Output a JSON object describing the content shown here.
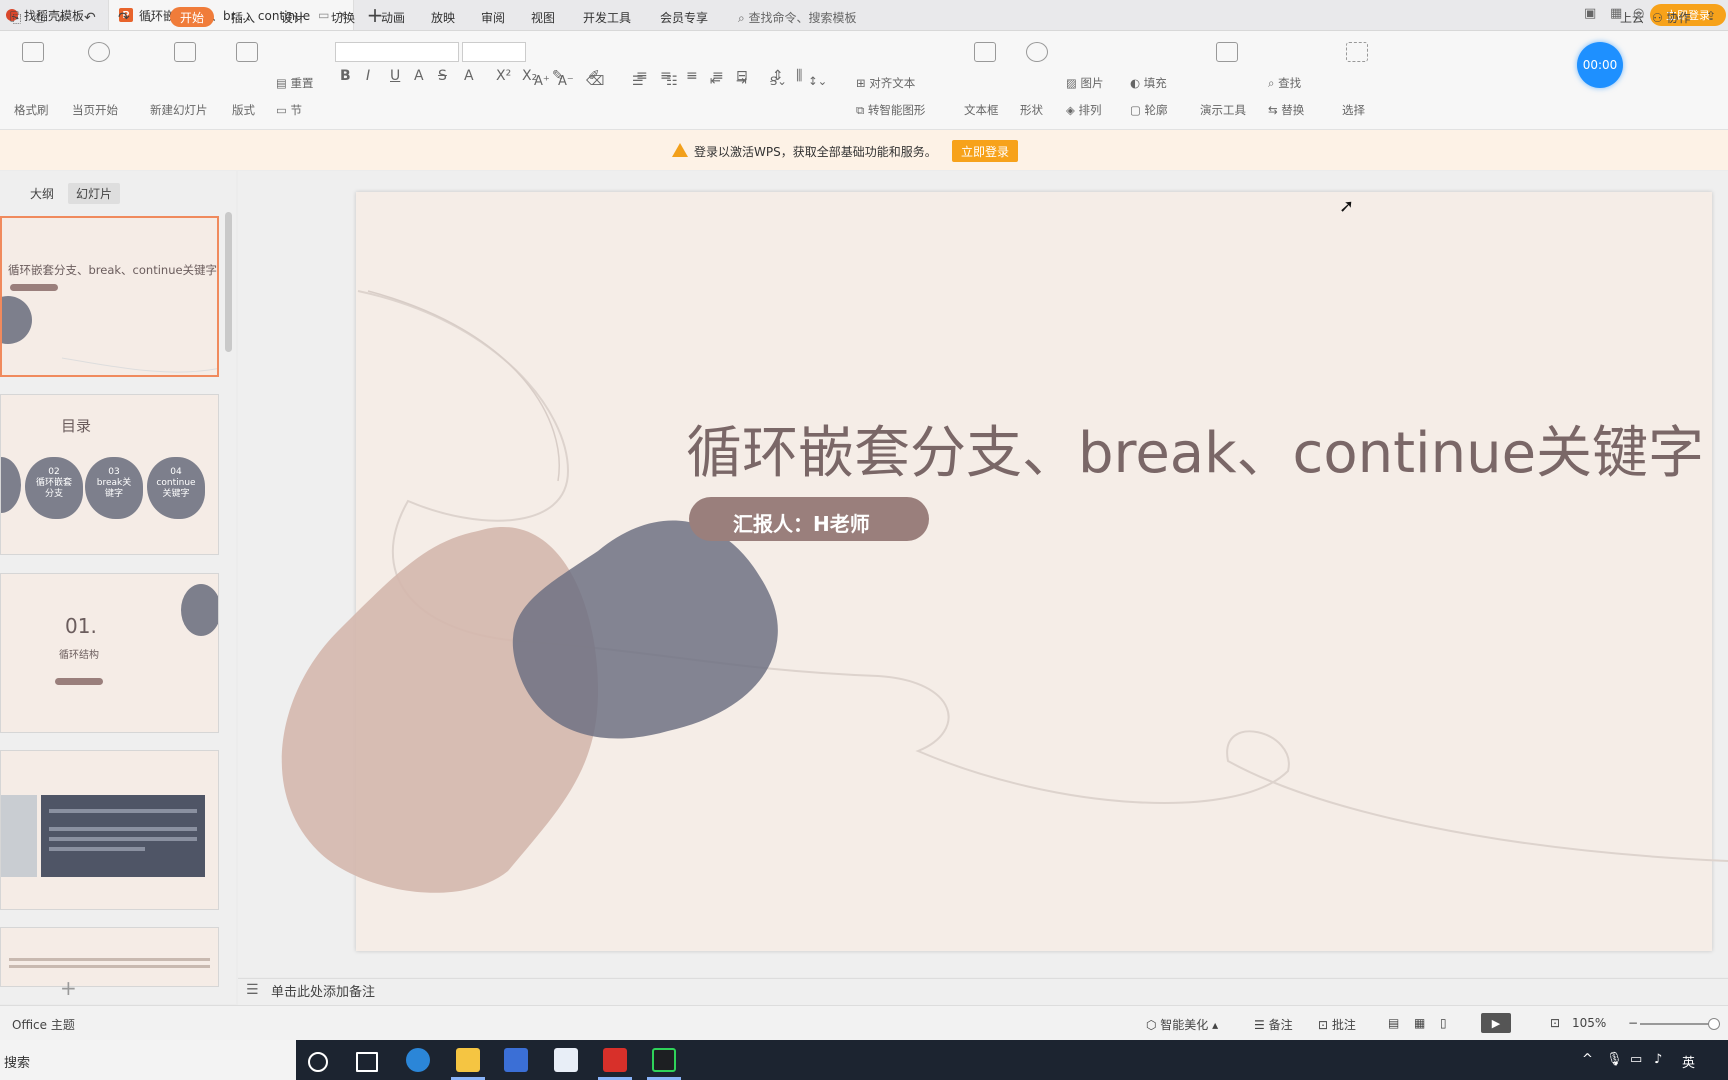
{
  "tabs": [
    {
      "label": "找稻壳模板"
    },
    {
      "label": "循环嵌套分支、br...、continue"
    }
  ],
  "titlebar": {
    "login_label": "立即登录"
  },
  "menu": {
    "start": "开始",
    "items": [
      "插入",
      "设计",
      "切换",
      "动画",
      "放映",
      "审阅",
      "视图",
      "开发工具",
      "会员专享"
    ],
    "search_placeholder": "查找命令、搜索模板",
    "cloud": "上云",
    "collab": "协作"
  },
  "timer": "00:00",
  "ribbon": {
    "format_painter": "格式刷",
    "play_from_current": "当页开始",
    "new_slide": "新建幻灯片",
    "layout": "版式",
    "section": "节",
    "reset": "重置",
    "align_text": "对齐文本",
    "smart_graphic": "转智能图形",
    "textbox": "文本框",
    "shape": "形状",
    "arrange": "排列",
    "picture": "图片",
    "fill": "填充",
    "outline": "轮廓",
    "present_tools": "演示工具",
    "find": "查找",
    "replace": "替换",
    "select": "选择"
  },
  "notice": {
    "text": "登录以激活WPS，获取全部基础功能和服务。",
    "button": "立即登录"
  },
  "panel": {
    "tab_outline": "大纲",
    "tab_slides": "幻灯片",
    "thumb1_title": "循环嵌套分支、break、continue关键字",
    "thumb2_title": "目录",
    "thumb2_items": [
      {
        "num": "02",
        "text": "循环嵌套分支"
      },
      {
        "num": "03",
        "text": "break关键字"
      },
      {
        "num": "04",
        "text": "continue关键字"
      }
    ],
    "thumb3_num": "01.",
    "thumb3_title": "循环结构"
  },
  "slide": {
    "title": "循环嵌套分支、break、continue关键字",
    "presenter": "汇报人：H老师"
  },
  "notes_placeholder": "单击此处添加备注",
  "status": {
    "theme": "Office 主题",
    "beautify": "智能美化",
    "notes": "备注",
    "comments": "批注",
    "zoom": "105%"
  },
  "taskbar": {
    "search": "搜索",
    "ime": "英"
  }
}
